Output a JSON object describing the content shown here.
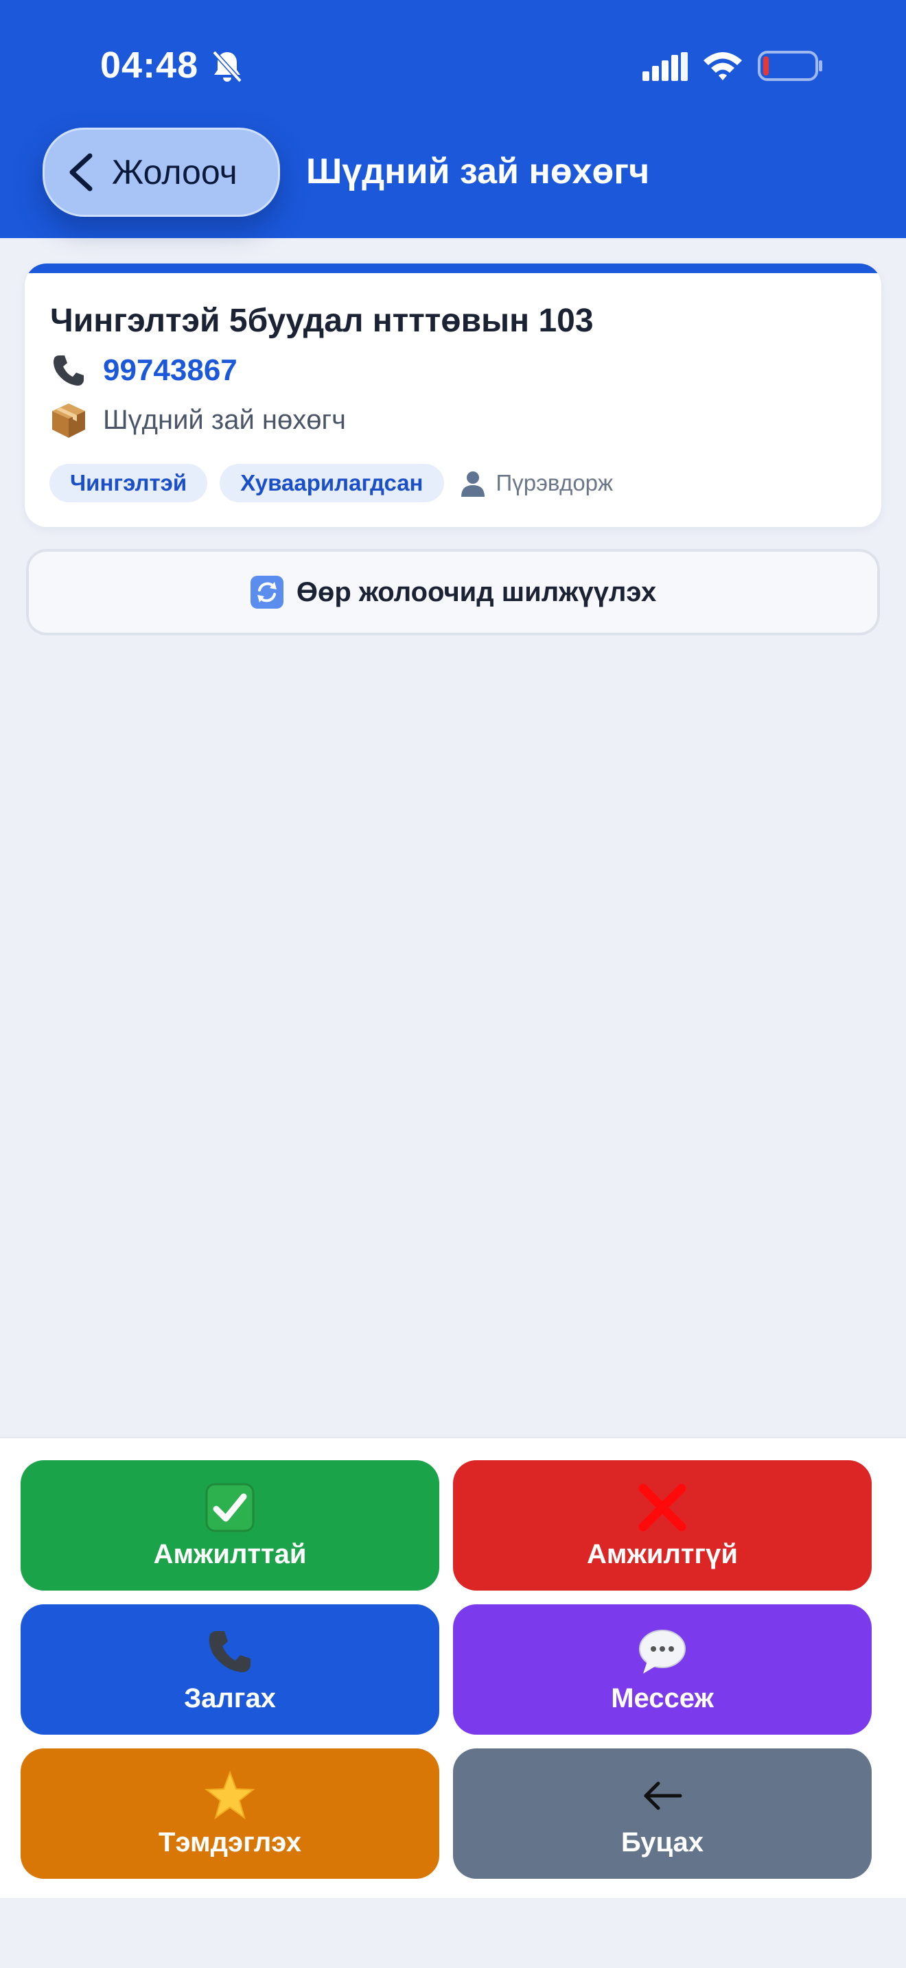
{
  "status_bar": {
    "time": "04:48",
    "icons": [
      "bell-slash-icon",
      "cellular-signal-icon",
      "wifi-icon",
      "battery-low-icon"
    ]
  },
  "header": {
    "back_label": "Жолооч",
    "title": "Шүдний зай нөхөгч",
    "color": "#1B58DA"
  },
  "order": {
    "address": "Чингэлтэй 5буудал нтттөвын 103",
    "phone": "99743867",
    "description": "Шүдний зай нөхөгч",
    "district_badge": "Чингэлтэй",
    "status_badge": "Хуваарилагдсан",
    "driver_name": "Пүрэвдорж"
  },
  "transfer": {
    "label": "Өөр жолоочид шилжүүлэх",
    "icon": "refresh-icon"
  },
  "actions": [
    {
      "label": "Амжилттай",
      "icon": "check-icon",
      "color": "#1BA34A"
    },
    {
      "label": "Амжилтгүй",
      "icon": "cross-icon",
      "color": "#DC2626"
    },
    {
      "label": "Залгах",
      "icon": "phone-icon",
      "color": "#1B58DA"
    },
    {
      "label": "Мессеж",
      "icon": "message-bubble-icon",
      "color": "#7C3AED"
    },
    {
      "label": "Тэмдэглэх",
      "icon": "star-icon",
      "color": "#D97706"
    },
    {
      "label": "Буцах",
      "icon": "arrow-left-icon",
      "color": "#64748B"
    }
  ]
}
